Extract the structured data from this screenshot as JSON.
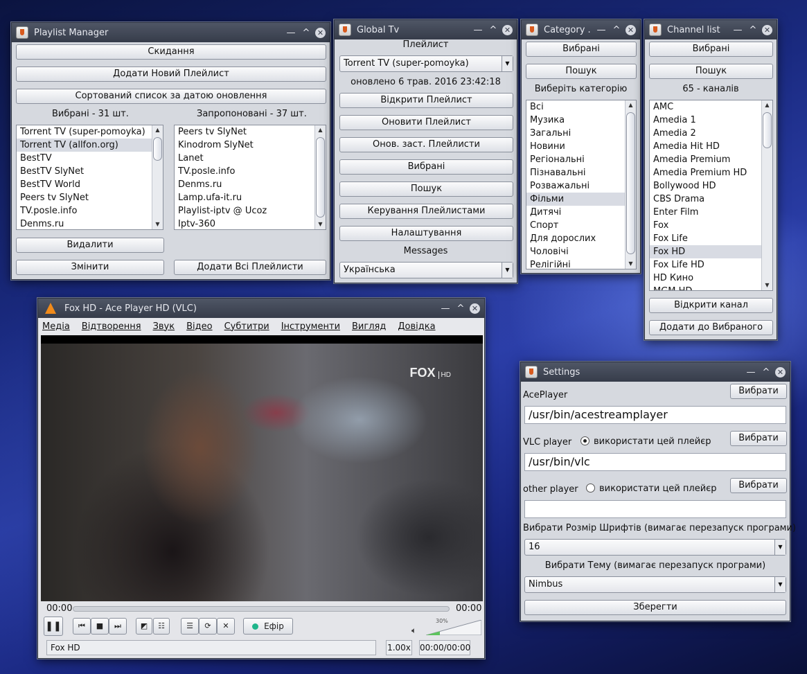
{
  "playlist_manager": {
    "title": "Playlist Manager",
    "reset": "Скидання",
    "add_new": "Додати Новий Плейлист",
    "sorted": "Сортований список за датою оновлення",
    "fav_label": "Вибрані - 31 шт.",
    "suggested_label": "Запропоновані - 37 шт.",
    "favorites": [
      "Torrent TV (super-pomoyka)",
      "Torrent TV (allfon.org)",
      "BestTV",
      "BestTV SlyNet",
      "BestTV World",
      "Peers tv SlyNet",
      "TV.posle.info",
      "Denms.ru"
    ],
    "suggested": [
      "Peers tv SlyNet",
      "Kinodrom SlyNet",
      "Lanet",
      "TV.posle.info",
      "Denms.ru",
      "Lamp.ufa-it.ru",
      "Playlist-iptv @ Ucoz",
      "Iptv-360"
    ],
    "delete": "Видалити",
    "change": "Змінити",
    "add_all": "Додати Всі Плейлисти"
  },
  "global_tv": {
    "title": "Global Tv",
    "playlist_label": "Плейлист",
    "playlist_value": "Torrent TV (super-pomoyka)",
    "updated": "оновлено  6 трав. 2016 23:42:18",
    "open": "Відкрити Плейлист",
    "refresh": "Оновити Плейлист",
    "refresh_old": "Онов. заст. Плейлисти",
    "favorites": "Вибрані",
    "search": "Пошук",
    "manage": "Керування Плейлистами",
    "settings": "Налаштування",
    "messages": "Messages",
    "language": "Українська"
  },
  "category": {
    "title": "Category ...",
    "favorites": "Вибрані",
    "search": "Пошук",
    "choose": "Виберіть категорію",
    "items": [
      "Всі",
      "Музика",
      "Загальні",
      "Новини",
      "Регіональні",
      "Пізнавальні",
      "Розважальні",
      "Фільми",
      "Дитячі",
      "Спорт",
      "Для дорослих",
      "Чоловічі",
      "Релігійні"
    ]
  },
  "channels": {
    "title": "Channel list",
    "favorites": "Вибрані",
    "search": "Пошук",
    "count": "65 -  каналів",
    "items": [
      "AMC",
      "Amedia 1",
      "Amedia 2",
      "Amedia Hit HD",
      "Amedia Premium",
      "Amedia Premium HD",
      "Bollywood HD",
      "CBS Drama",
      "Enter Film",
      "Fox",
      "Fox Life",
      "Fox HD",
      "Fox Life HD",
      "HD Кино",
      "MGM HD"
    ],
    "open": "Відкрити канал",
    "add_fav": "Додати до Вибраного"
  },
  "vlc": {
    "title": "Fox HD - Ace Player HD (VLC)",
    "menu": [
      "Медіа",
      "Відтворення",
      "Звук",
      "Відео",
      "Субтитри",
      "Інструменти",
      "Вигляд",
      "Довідка"
    ],
    "logo": "FOX",
    "logo_sub": "HD",
    "time_left": "00:00",
    "time_right": "00:00",
    "live": "Ефір",
    "volume": "30%",
    "status": "Fox HD",
    "speed": "1.00x",
    "time": "00:00/00:00"
  },
  "settings": {
    "title": "Settings",
    "aceplayer": "AcePlayer",
    "choose": "Вибрати",
    "ace_path": "/usr/bin/acestreamplayer",
    "vlc_label": "VLC player",
    "use_player": "використати цей плейєр",
    "vlc_path": "/usr/bin/vlc",
    "other_label": "other player",
    "other_path": "",
    "font_label": "Вибрати Розмір Шрифтів (вимагає перезапуск програми)",
    "font_size": "16",
    "theme_label": "Вибрати Тему (вимагає перезапуск програми)",
    "theme": "Nimbus",
    "save": "Зберегти"
  }
}
